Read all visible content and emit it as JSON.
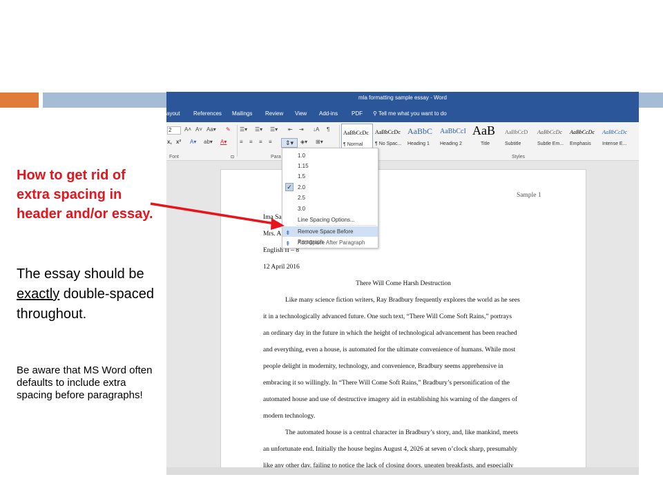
{
  "slide": {
    "heading_red": "How to get rid of extra spacing in header and/or essay.",
    "main_text_pre": "The essay should be ",
    "main_text_underlined": "exactly",
    "main_text_post": " double-spaced throughout.",
    "small_text": "Be aware that MS Word often defaults to include extra spacing before paragraphs!",
    "colors": {
      "red": "#e8141c",
      "orange": "#e07b39",
      "blue_bar": "#a5bcd6",
      "word_blue": "#2b579a"
    }
  },
  "word": {
    "window_title": "mla formatting sample essay - Word",
    "tabs": [
      "ayout",
      "References",
      "Mailings",
      "Review",
      "View",
      "Add-ins",
      "PDF"
    ],
    "tell_me": "Tell me what you want to do",
    "font_size": "2",
    "font_group_label": "Font",
    "para_group_label": "Para",
    "styles_group_label": "Styles",
    "styles": [
      {
        "sample": "AaBbCcDc",
        "name": "¶ Normal"
      },
      {
        "sample": "AaBbCcDc",
        "name": "¶ No Spac..."
      },
      {
        "sample": "AaBbC",
        "name": "Heading 1"
      },
      {
        "sample": "AaBbCcI",
        "name": "Heading 2"
      },
      {
        "sample": "AaB",
        "name": "Title"
      },
      {
        "sample": "AaBbCcD",
        "name": "Subtitle"
      },
      {
        "sample": "AaBbCcDc",
        "name": "Subtle Em..."
      },
      {
        "sample": "AaBbCcDc",
        "name": "Emphasis"
      },
      {
        "sample": "AaBbCcDc",
        "name": "Intense E..."
      }
    ],
    "line_spacing_menu": {
      "options": [
        "1.0",
        "1.15",
        "1.5",
        "2.0",
        "2.5",
        "3.0"
      ],
      "selected": "2.0",
      "line_spacing_options": "Line Spacing Options...",
      "remove_space_before": "Remove Space Before Paragraph",
      "add_space_after": "Add Space After Paragraph"
    },
    "document": {
      "header_right": "Sample 1",
      "lines": [
        "Ima Sa",
        "Mrs. A",
        "English II – 8",
        "12 April 2016"
      ],
      "essay_title": "There Will Come Harsh Destruction",
      "body": [
        "Like many science fiction writers, Ray Bradbury frequently explores the world as he sees",
        "it in a technologically advanced future. One such text, “There Will Come Soft Rains,” portrays",
        "an ordinary day in the future in which the height of technological advancement has been reached",
        "and everything, even a house, is automated for the ultimate convenience of humans. While most",
        "people delight in modernity, technology, and convenience, Bradbury seems apprehensive in",
        "embracing it so willingly. In “There Will Come Soft Rains,” Bradbury’s personification of the",
        "automated house and use of destructive imagery aid in establishing his warning of the dangers of",
        "modern technology.",
        "The automated house is a central character in Bradbury’s story, and, like mankind, meets",
        "an unfortunate end. Initially the house begins August 4, 2026 at seven o’clock sharp, presumably",
        "like any other day, failing to notice the lack of closing doors, uneaten breakfasts, and especially"
      ]
    }
  }
}
